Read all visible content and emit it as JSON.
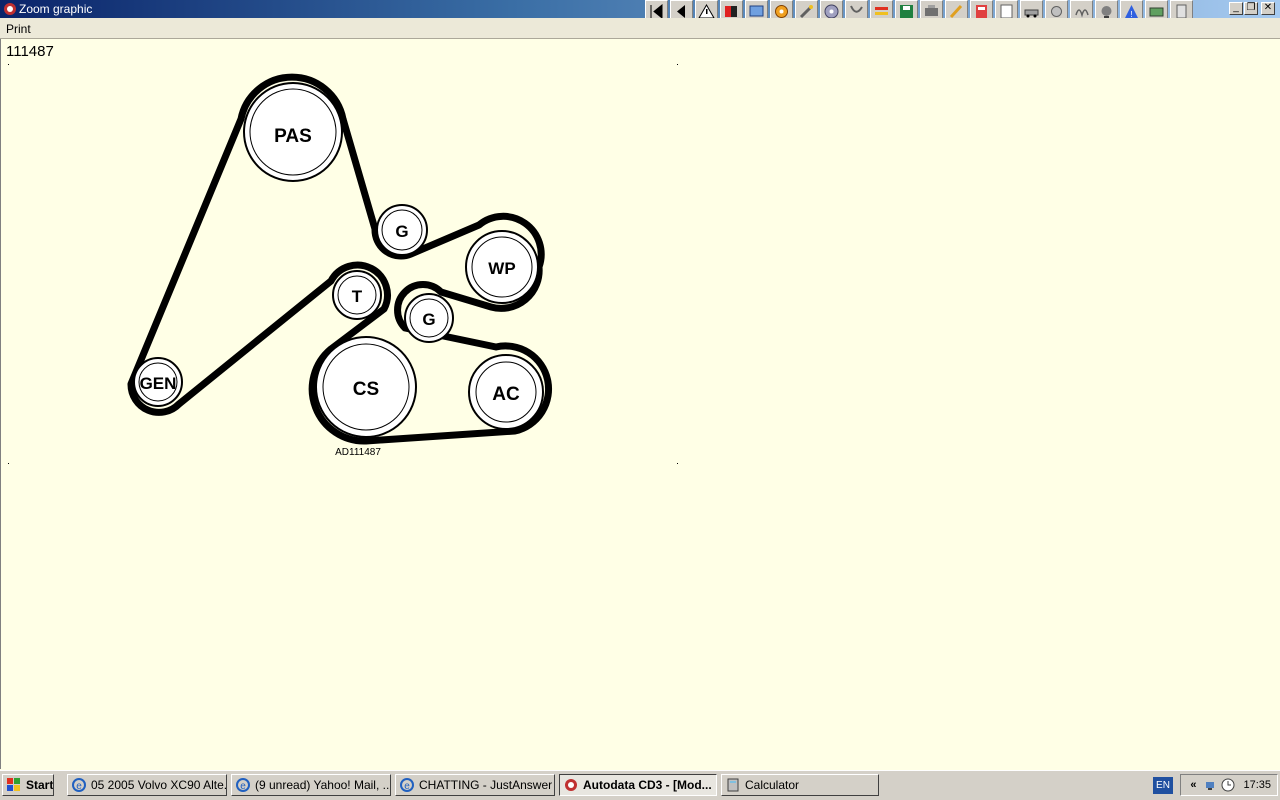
{
  "window": {
    "title": "Zoom graphic"
  },
  "menu": {
    "print": "Print"
  },
  "toolbar": {
    "buttons": [
      "first-icon",
      "back-icon",
      "warning-icon",
      "color-icon",
      "screen-icon",
      "settings-icon",
      "tool-icon",
      "disc-icon",
      "cable-icon",
      "bars-icon",
      "save-icon",
      "engine-icon",
      "pencil-icon",
      "calc-icon",
      "doc-icon",
      "car-icon",
      "hand-icon",
      "spring-icon",
      "globe-icon",
      "alert-icon",
      "battery-icon",
      "list-icon"
    ]
  },
  "diagram": {
    "figure_id": "111487",
    "caption": "AD111487",
    "pulleys": {
      "pas": "PAS",
      "g1": "G",
      "wp": "WP",
      "t": "T",
      "g2": "G",
      "gen": "GEN",
      "cs": "CS",
      "ac": "AC"
    }
  },
  "taskbar": {
    "start": "Start",
    "tasks": [
      {
        "label": "05 2005 Volvo XC90 Alte..."
      },
      {
        "label": "(9 unread) Yahoo! Mail, ..."
      },
      {
        "label": "CHATTING - JustAnswer ..."
      },
      {
        "label": "Autodata CD3 - [Mod..."
      },
      {
        "label": "Calculator"
      }
    ],
    "lang": "EN",
    "clock": "17:35"
  }
}
